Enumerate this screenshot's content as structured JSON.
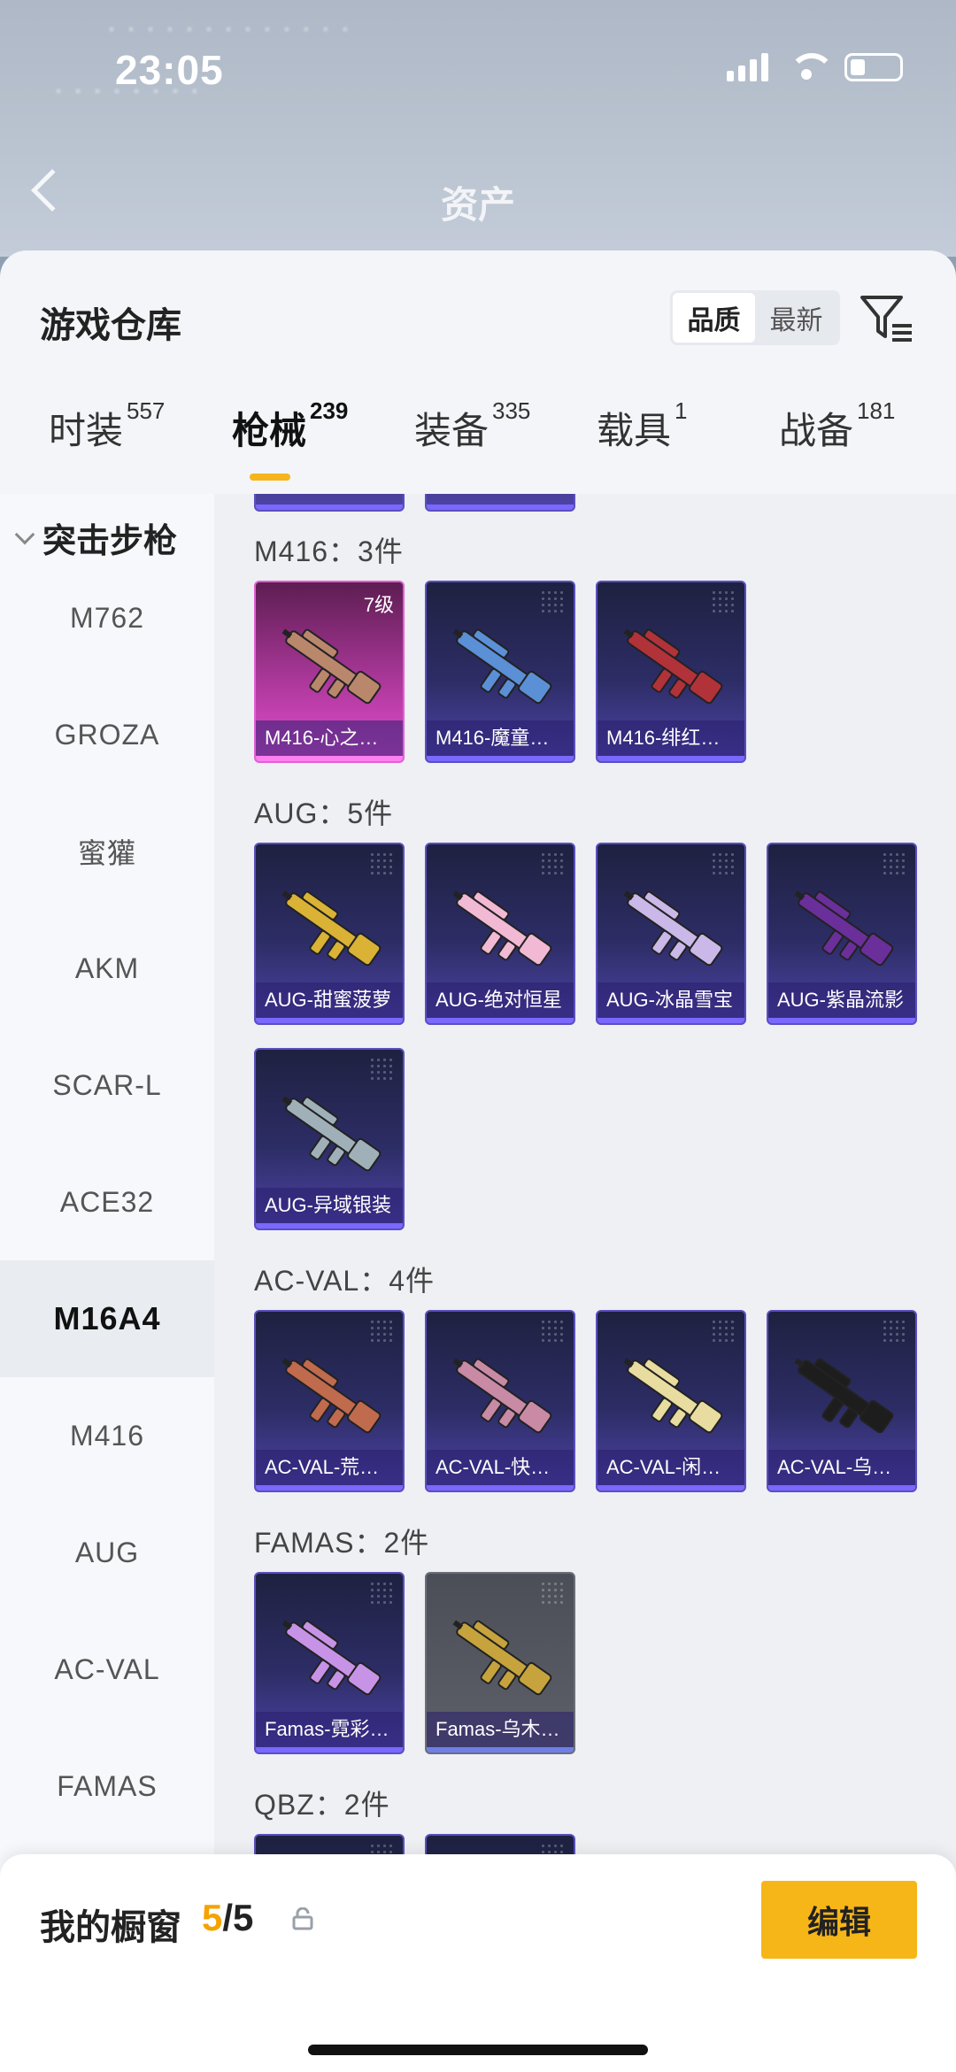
{
  "status_bar": {
    "time": "23:05"
  },
  "header": {
    "title": "资产"
  },
  "sheet": {
    "title": "游戏仓库",
    "sort_options": [
      "品质",
      "最新"
    ],
    "active_sort": "品质"
  },
  "tabs": [
    {
      "label": "时装",
      "count": "557"
    },
    {
      "label": "枪械",
      "count": "239",
      "active": true
    },
    {
      "label": "装备",
      "count": "335"
    },
    {
      "label": "载具",
      "count": "1"
    },
    {
      "label": "战备",
      "count": "181"
    }
  ],
  "sidebar": {
    "category": "突击步枪",
    "items": [
      "M762",
      "GROZA",
      "蜜獾",
      "AKM",
      "SCAR-L",
      "ACE32",
      "M16A4",
      "M416",
      "AUG",
      "AC-VAL",
      "FAMAS"
    ],
    "active": "M16A4"
  },
  "groups": [
    {
      "title": "M416：3件",
      "items": [
        {
          "name": "M416-心之…",
          "level": "7级",
          "rarity": "pink",
          "gun_color": "#b9876c"
        },
        {
          "name": "M416-魔童…",
          "rarity": "purple",
          "gun_color": "#5b8fd6"
        },
        {
          "name": "M416-绯红…",
          "rarity": "purple",
          "gun_color": "#b2323a"
        }
      ]
    },
    {
      "title": "AUG：5件",
      "items": [
        {
          "name": "AUG-甜蜜菠萝",
          "rarity": "purple",
          "gun_color": "#d9b236"
        },
        {
          "name": "AUG-绝对恒星",
          "rarity": "purple",
          "gun_color": "#f1b9d4"
        },
        {
          "name": "AUG-冰晶雪宝",
          "rarity": "purple",
          "gun_color": "#c9b8e8"
        },
        {
          "name": "AUG-紫晶流影",
          "rarity": "purple",
          "gun_color": "#6a2f9a"
        },
        {
          "name": "AUG-异域银装",
          "rarity": "purple",
          "gun_color": "#9fb0b8"
        }
      ]
    },
    {
      "title": "AC-VAL：4件",
      "items": [
        {
          "name": "AC-VAL-荒…",
          "rarity": "purple",
          "gun_color": "#c06a4e"
        },
        {
          "name": "AC-VAL-快…",
          "rarity": "purple",
          "gun_color": "#c88aa4"
        },
        {
          "name": "AC-VAL-闲…",
          "rarity": "purple",
          "gun_color": "#e8dca0"
        },
        {
          "name": "AC-VAL-乌…",
          "rarity": "purple",
          "gun_color": "#1d1d1d"
        }
      ]
    },
    {
      "title": "FAMAS：2件",
      "items": [
        {
          "name": "Famas-霓彩…",
          "rarity": "purple",
          "gun_color": "#c793e6"
        },
        {
          "name": "Famas-乌木…",
          "rarity": "gray",
          "gun_color": "#c6a33c"
        }
      ]
    },
    {
      "title": "QBZ：2件",
      "items": [
        {
          "name": "",
          "rarity": "purple",
          "gun_color": "#666"
        },
        {
          "name": "",
          "rarity": "purple",
          "gun_color": "#666"
        }
      ]
    }
  ],
  "showcase": {
    "title": "我的橱窗",
    "current": "5",
    "total": "/5",
    "edit_label": "编辑"
  },
  "colors": {
    "accent": "#f7b618",
    "rare": "#5a4fbf",
    "legendary": "#e25fd4"
  },
  "icons": [
    "back-arrow-icon",
    "filter-icon",
    "share-icon",
    "lock-icon",
    "chevron-down-icon"
  ]
}
